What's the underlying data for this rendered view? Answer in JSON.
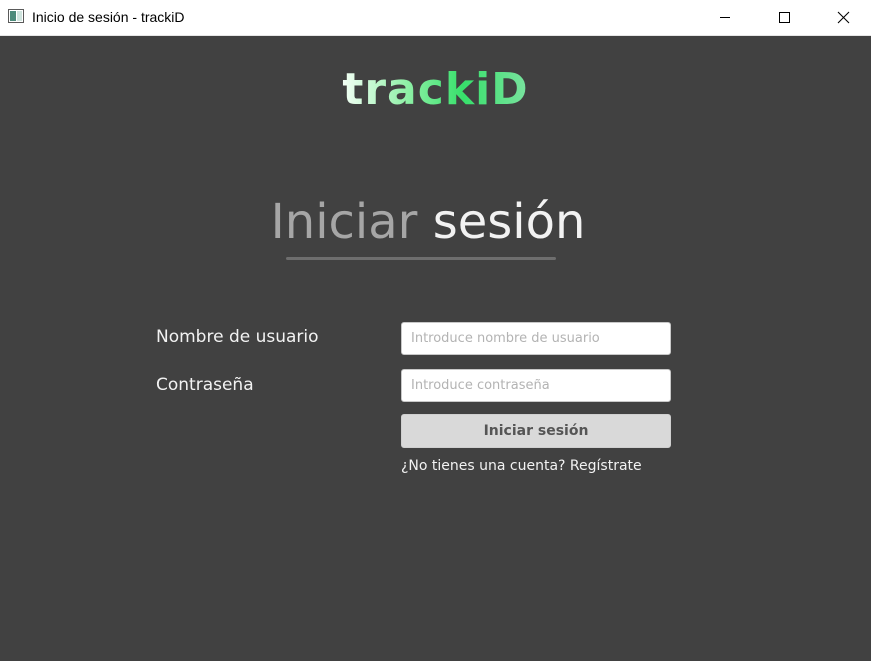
{
  "window": {
    "title": "Inicio de sesión - trackiD"
  },
  "titlebar": {
    "minimize_icon": "minimize-icon",
    "maximize_icon": "maximize-icon",
    "close_icon": "close-icon"
  },
  "logo": {
    "text": "trackiD"
  },
  "heading": {
    "word1": "Iniciar",
    "word2": "sesión"
  },
  "form": {
    "username_label": "Nombre de usuario",
    "username_placeholder": "Introduce nombre de usuario",
    "username_value": "",
    "password_label": "Contraseña",
    "password_placeholder": "Introduce contraseña",
    "password_value": "",
    "submit_label": "Iniciar sesión",
    "register_link": "¿No tienes una cuenta? Regístrate"
  },
  "colors": {
    "background": "#414141",
    "logo_accent": "#37e06b",
    "button_bg": "#d9d9d9"
  }
}
